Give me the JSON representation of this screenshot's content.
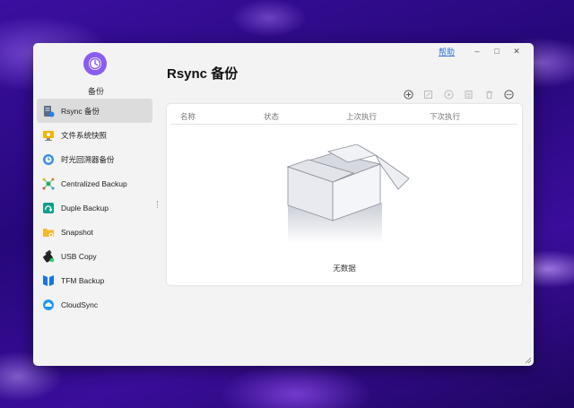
{
  "window": {
    "help_label": "帮助",
    "minimize_symbol": "–",
    "maximize_symbol": "□",
    "close_symbol": "✕"
  },
  "app": {
    "name": "备份",
    "logo_icon": "clock-icon",
    "accent_color": "#8a5cf0"
  },
  "sidebar": {
    "items": [
      {
        "label": "Rsync 备份",
        "icon": "rsync-server-icon",
        "active": true
      },
      {
        "label": "文件系统快照",
        "icon": "snapshot-monitor-icon"
      },
      {
        "label": "时光回溯器备份",
        "icon": "time-machine-icon"
      },
      {
        "label": "Centralized Backup",
        "icon": "centralized-network-icon"
      },
      {
        "label": "Duple Backup",
        "icon": "duple-backup-icon"
      },
      {
        "label": "Snapshot",
        "icon": "folder-snapshot-icon"
      },
      {
        "label": "USB Copy",
        "icon": "usb-copy-icon"
      },
      {
        "label": "TFM Backup",
        "icon": "tfm-backup-icon"
      },
      {
        "label": "CloudSync",
        "icon": "cloud-sync-icon"
      }
    ]
  },
  "main": {
    "title": "Rsync 备份",
    "toolbar": [
      "add-icon",
      "edit-icon",
      "play-icon",
      "log-icon",
      "delete-icon",
      "more-icon"
    ],
    "table": {
      "columns": [
        "名称",
        "状态",
        "上次执行",
        "下次执行"
      ],
      "rows": []
    },
    "empty_text": "无数据"
  }
}
